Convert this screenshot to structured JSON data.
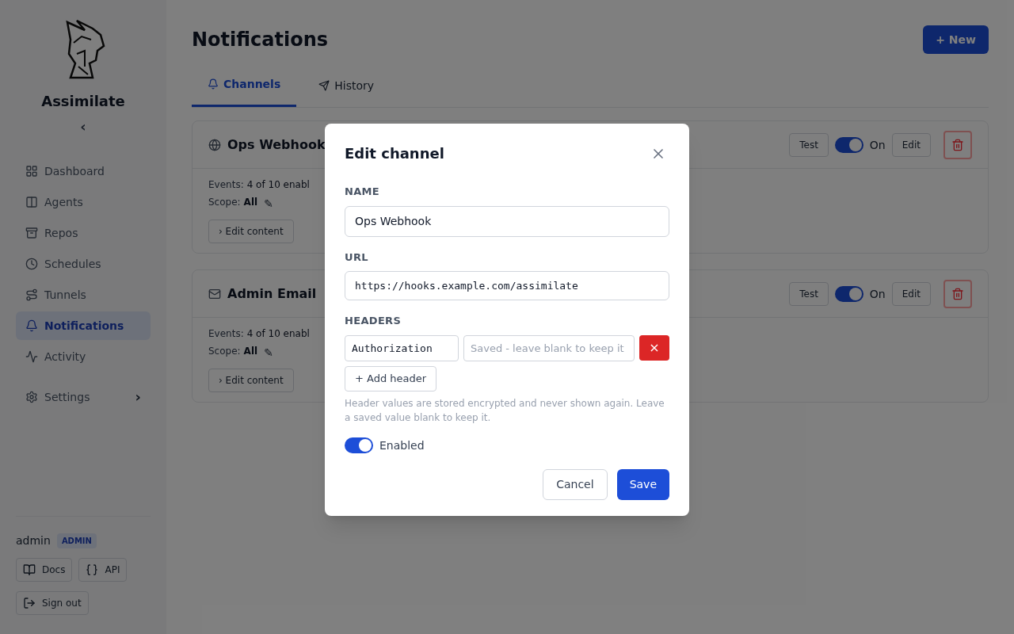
{
  "sidebar": {
    "brand": "Assimilate",
    "collapse": "‹",
    "items": [
      {
        "label": "Dashboard",
        "selected": false
      },
      {
        "label": "Agents",
        "selected": false
      },
      {
        "label": "Repos",
        "selected": false
      },
      {
        "label": "Schedules",
        "selected": false
      },
      {
        "label": "Tunnels",
        "selected": false
      },
      {
        "label": "Notifications",
        "selected": true
      },
      {
        "label": "Activity",
        "selected": false
      }
    ],
    "settings": {
      "label": "Settings",
      "chevron": "›"
    },
    "user": {
      "name": "admin",
      "role": "ADMIN"
    },
    "footer_buttons": [
      {
        "label": "Docs"
      },
      {
        "label": "API"
      }
    ],
    "sign_out": "Sign out"
  },
  "page": {
    "title": "Notifications",
    "new_button": "+ New",
    "tabs": [
      {
        "label": "Channels",
        "selected": true
      },
      {
        "label": "History",
        "selected": false
      }
    ],
    "channels": [
      {
        "name": "Ops Webhook",
        "events_label": "Events:",
        "events": "4 of 10 enabl",
        "scope_label": "Scope:",
        "scope": "All",
        "scope_edit": "✎",
        "edit_content": "› Edit content",
        "test": "Test",
        "on": true,
        "on_label": "On",
        "edit": "Edit"
      },
      {
        "name": "Admin Email",
        "events_label": "Events:",
        "events": "4 of 10 enabl",
        "scope_label": "Scope:",
        "scope": "All",
        "scope_edit": "✎",
        "edit_content": "› Edit content",
        "test": "Test",
        "on": true,
        "on_label": "On",
        "edit": "Edit"
      }
    ]
  },
  "dialog": {
    "title": "Edit channel",
    "name_label": "NAME",
    "name_value": "Ops Webhook",
    "url_label": "URL",
    "url_value": "https://hooks.example.com/assimilate",
    "headers_label": "HEADERS",
    "headers": [
      {
        "key": "Authorization",
        "placeholder": "Saved - leave blank to keep it",
        "remove": "×"
      }
    ],
    "add_header": "+ Add header",
    "hint": "Header values are stored encrypted and never shown again. Leave a saved value blank to keep it.",
    "enabled": {
      "on": true,
      "label": "Enabled"
    },
    "cancel": "Cancel",
    "save": "Save"
  }
}
